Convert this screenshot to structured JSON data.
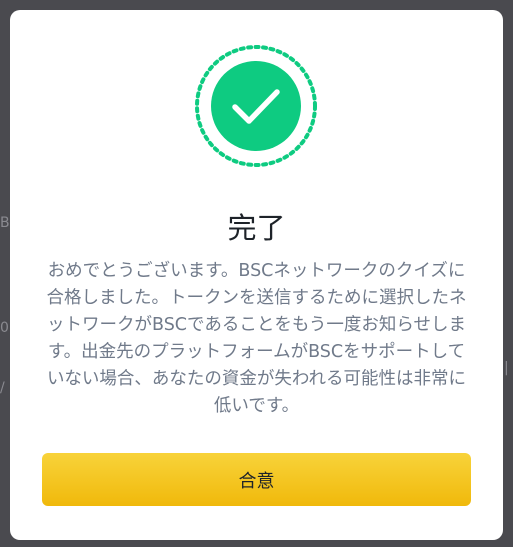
{
  "dialog": {
    "title": "完了",
    "message": "おめでとうございます。BSCネットワークのクイズに合格しました。トークンを送信するために選択したネットワークがBSCであることをもう一度お知らせします。出金先のプラットフォームがBSCをサポートしていない場合、あなたの資金が失われる可能性は非常に低いです。",
    "agree_label": "合意",
    "icon": "check-circle-icon"
  },
  "colors": {
    "success": "#0ecb81",
    "accent": "#f0b90b",
    "title": "#1e2329",
    "body_text": "#707a8a",
    "overlay": "#4a4a4f"
  }
}
